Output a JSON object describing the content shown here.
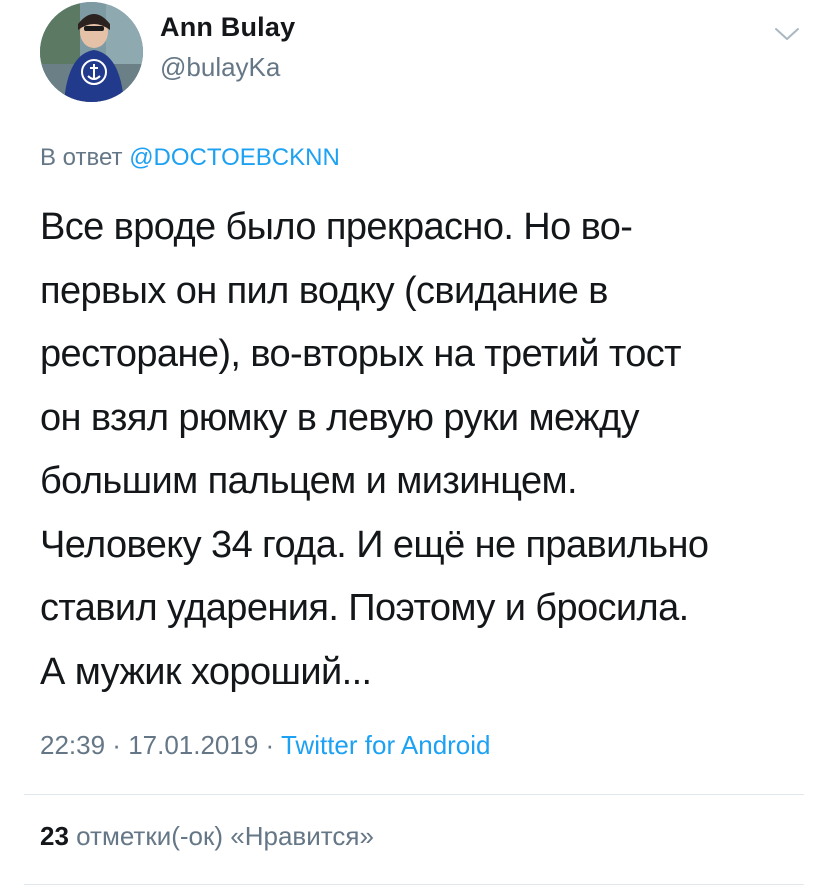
{
  "author": {
    "name": "Ann Bulay",
    "handle": "@bulayKa"
  },
  "reply": {
    "prefix": "В ответ",
    "mention": "@DOCTOEBCKNN"
  },
  "tweet": {
    "text": "Все вроде было прекрасно. Но во-\nпервых он пил водку (свидание в\nресторане), во-вторых на третий тост\nон взял рюмку в левую руки между\nбольшим пальцем и мизинцем.\nЧеловеку 34 года. И ещё не правильно\nставил ударения. Поэтому и бросила.\nА мужик хороший..."
  },
  "meta": {
    "time": "22:39",
    "separator_1": " · ",
    "date": "17.01.2019",
    "separator_2": " · ",
    "source": "Twitter for Android"
  },
  "stats": {
    "likes_count": "23",
    "likes_label": "отметки(-ок) «Нравится»"
  },
  "icons": {
    "menu": "chevron-down-icon",
    "avatar": "profile-photo"
  },
  "colors": {
    "text": "#14171a",
    "secondary": "#657786",
    "link": "#1da1f2",
    "divider": "#e1e8ed"
  }
}
